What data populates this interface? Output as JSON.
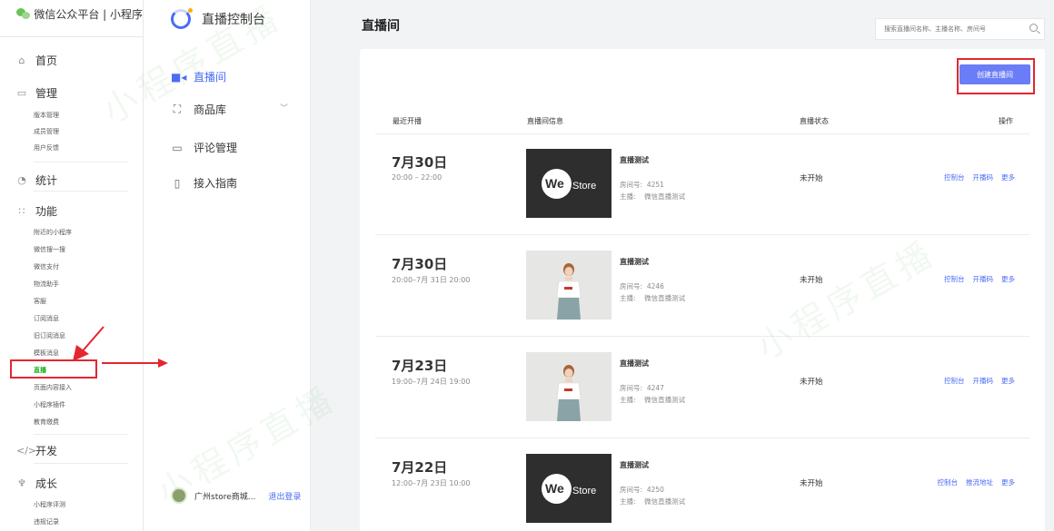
{
  "platform": {
    "title": "微信公众平台 | 小程序"
  },
  "sidebar": {
    "home": "首页",
    "manage": "管理",
    "manage_items": [
      "版本管理",
      "成员管理",
      "用户反馈"
    ],
    "stats": "统计",
    "features": "功能",
    "feature_items": [
      "附近的小程序",
      "微信搜一搜",
      "微信支付",
      "物流助手",
      "客服",
      "订阅消息",
      "旧订阅消息",
      "模板消息",
      "直播",
      "页面内容接入",
      "小程序插件",
      "教育缴费"
    ],
    "dev": "开发",
    "growth": "成长",
    "growth_items": [
      "小程序评测",
      "违规记录"
    ]
  },
  "console": {
    "title": "直播控制台",
    "menu": [
      "直播间",
      "商品库",
      "评论管理",
      "接入指南"
    ],
    "shop_name": "广州store商城...",
    "logout": "退出登录"
  },
  "main": {
    "title": "直播间",
    "search_placeholder": "搜索直播间名称、主播名称、房间号",
    "create_button": "创建直播间",
    "columns": [
      "最近开播",
      "直播间信息",
      "直播状态",
      "操作"
    ],
    "rows": [
      {
        "date": "7月30日",
        "time": "20:00 – 22:00",
        "name": "直播测试",
        "room_label": "房间号:",
        "room_id": "4251",
        "host_label": "主播:",
        "host": "微信直播测试",
        "status": "未开始",
        "thumb": "westore-logo",
        "ops": [
          "控制台",
          "开播码",
          "更多"
        ]
      },
      {
        "date": "7月30日",
        "time": "20:00–7月 31日 20:00",
        "name": "直播测试",
        "room_label": "房间号:",
        "room_id": "4246",
        "host_label": "主播:",
        "host": "微信直播测试",
        "status": "未开始",
        "thumb": "model-photo",
        "ops": [
          "控制台",
          "开播码",
          "更多"
        ]
      },
      {
        "date": "7月23日",
        "time": "19:00–7月 24日 19:00",
        "name": "直播测试",
        "room_label": "房间号:",
        "room_id": "4247",
        "host_label": "主播:",
        "host": "微信直播测试",
        "status": "未开始",
        "thumb": "model-photo",
        "ops": [
          "控制台",
          "开播码",
          "更多"
        ]
      },
      {
        "date": "7月22日",
        "time": "12:00–7月 23日 10:00",
        "name": "直播测试",
        "room_label": "房间号:",
        "room_id": "4250",
        "host_label": "主播:",
        "host": "微信直播测试",
        "status": "未开始",
        "thumb": "westore-logo",
        "ops": [
          "控制台",
          "推流地址",
          "更多"
        ]
      }
    ]
  },
  "thumb_text": {
    "we": "We",
    "store": "Store"
  },
  "watermark": "小程序直播",
  "colors": {
    "accent": "#4a6cf7",
    "wechat_green": "#1aad19",
    "highlight_red": "#e4262f",
    "button": "#6b7cf7"
  }
}
